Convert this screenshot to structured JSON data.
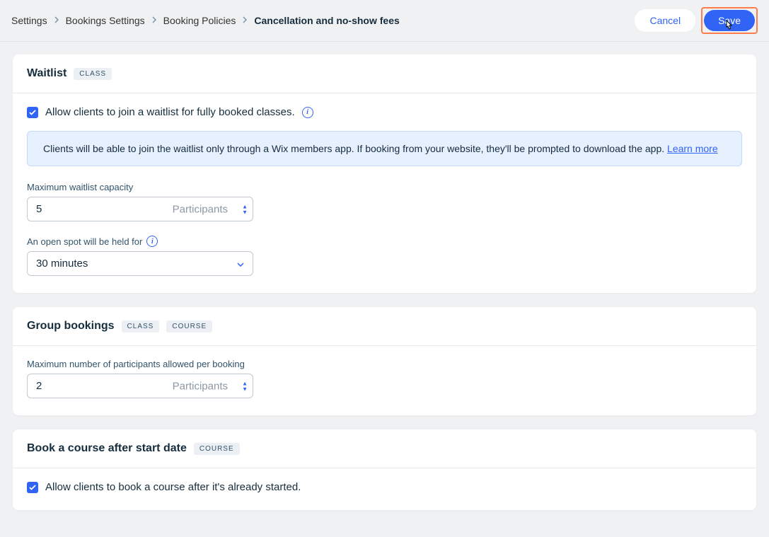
{
  "breadcrumbs": {
    "items": [
      "Settings",
      "Bookings Settings",
      "Booking Policies"
    ],
    "current": "Cancellation and no-show fees"
  },
  "header": {
    "cancel": "Cancel",
    "save": "Save"
  },
  "waitlist": {
    "title": "Waitlist",
    "badge": "CLASS",
    "checkbox_label": "Allow clients to join a waitlist for fully booked classes.",
    "checkbox_checked": true,
    "banner_text": "Clients will be able to join the waitlist only through a Wix members app. If booking from your website, they'll be prompted to download the app. ",
    "banner_link": "Learn more",
    "capacity_label": "Maximum waitlist capacity",
    "capacity_value": "5",
    "capacity_suffix": "Participants",
    "hold_label": "An open spot will be held for",
    "hold_value": "30 minutes"
  },
  "group_bookings": {
    "title": "Group bookings",
    "badge1": "CLASS",
    "badge2": "COURSE",
    "max_label": "Maximum number of participants allowed per booking",
    "max_value": "2",
    "max_suffix": "Participants"
  },
  "book_after": {
    "title": "Book a course after start date",
    "badge": "COURSE",
    "checkbox_label": "Allow clients to book a course after it's already started.",
    "checkbox_checked": true
  }
}
